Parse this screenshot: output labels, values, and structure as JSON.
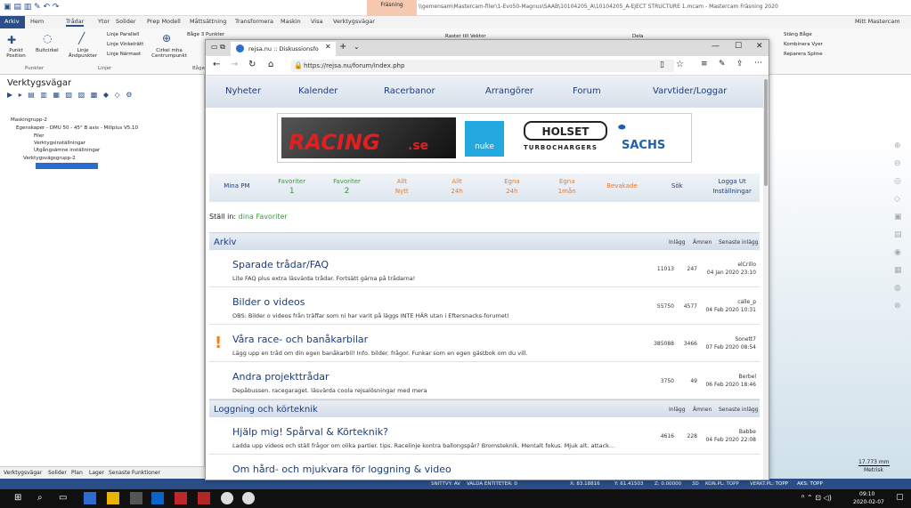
{
  "mastercam": {
    "title_path": "\\\\gemensam\\Mastercam-filer\\1-Evo50-Magnus\\SAAB\\10104205_A\\10104205_A-EJECT STRUCTURE 1.mcam - Mastercam Fräsning 2020",
    "context_tab": "Fräsning",
    "tabs": [
      "Arkiv",
      "Hem",
      "Trådar",
      "Ytor",
      "Solider",
      "Prep Modell",
      "Måttsättning",
      "Transformera",
      "Maskin",
      "Visa",
      "Verktygsvägar"
    ],
    "user": "Mitt Mastercam",
    "ribbon": {
      "punkt": "Punkt Position",
      "bultcirkel": "Bultcirkel",
      "linje_andp": "Linje Ändpunkter",
      "parallell": "Linje Parallell",
      "vinkelratt": "Linje Vinkelrätt",
      "narmast": "Linje Närmast",
      "cirkel": "Cirkel mha Centrumpunkt",
      "bage3": "Båge 3 Punkter",
      "group_punkter": "Punkter",
      "group_linjer": "Linjer",
      "group_bage": "Båge",
      "raster": "Raster till Vektor",
      "dela": "Dela",
      "stang": "Stäng Båge",
      "kombinera": "Kombinera Vyer",
      "reparera": "Reparera Spline"
    },
    "panel_title": "Verktygsvägar",
    "tree": [
      "Maskingrupp-2",
      "Egenskaper - DMU 50 - 45° B axis - Millplus V5.10",
      "Filer",
      "Verktygsinställningar",
      "Utgångsämne inställningar",
      "Verktygsvägsgrupp-2"
    ],
    "bottom_tabs": [
      "Verktygsvägar",
      "Solider",
      "Plan",
      "Lager",
      "Senaste Funktioner"
    ],
    "scale": "17.773 mm",
    "scale_unit": "Metrisk",
    "status": [
      "SNITTVY: AV",
      "VALDA ENTITETER: 0",
      "X:  83.18816",
      "Y:  61.41503",
      "Z:  0.00000",
      "3D",
      "KON.PL: TOPP",
      "VERKT.PL: TOPP",
      "AKS: TOPP"
    ]
  },
  "edge": {
    "tab_title": "rejsa.nu :: Diskussionsfo",
    "url_host": "rejsa.nu",
    "url": "https://rejsa.nu/forum/index.php",
    "nav": [
      "Nyheter",
      "Kalender",
      "Racerbanor",
      "Arrangörer",
      "Forum",
      "Varvtider/Loggar"
    ],
    "banner": {
      "racing": "RACING",
      "se": ".se",
      "nuke": "nuke",
      "holset": "HOLSET",
      "turbo": "TURBOCHARGERS",
      "sachs": "SACHS"
    },
    "links": [
      {
        "l1": "Mina PM",
        "l2": "",
        "color": "#1c3c7c"
      },
      {
        "l1": "Favoriter",
        "l2": "1",
        "color": "#3a9a3a"
      },
      {
        "l1": "Favoriter",
        "l2": "2",
        "color": "#3a9a3a"
      },
      {
        "l1": "Allt",
        "l2": "Nytt",
        "color": "#e67a2e"
      },
      {
        "l1": "Allt",
        "l2": "24h",
        "color": "#e67a2e"
      },
      {
        "l1": "Egna",
        "l2": "24h",
        "color": "#e67a2e"
      },
      {
        "l1": "Egna",
        "l2": "1mån",
        "color": "#e67a2e"
      },
      {
        "l1": "Bevakade",
        "l2": "",
        "color": "#e67a2e"
      },
      {
        "l1": "Sök",
        "l2": "",
        "color": "#1c3c7c"
      },
      {
        "l1": "Logga Ut",
        "l2": "Inställningar",
        "color": "#1c3c7c"
      }
    ],
    "stall_in": "Ställ in:",
    "stall_link": "dina Favoriter",
    "categories": [
      {
        "title": "Arkiv",
        "h_inlagg": "Inlägg",
        "h_amnen": "Ämnen",
        "h_senaste": "Senaste inlägg",
        "forums": [
          {
            "title": "Sparade trådar/FAQ",
            "desc": "Lite FAQ plus extra läsvärda trådar. Fortsätt gärna på trådarna!",
            "posts": "11013",
            "topics": "247",
            "user": "elCrillo",
            "date": "04 Jan 2020 23:10",
            "new": false
          },
          {
            "title": "Bilder o videos",
            "desc": "OBS: Bilder o videos från träffar som ni har varit på läggs INTE HÄR utan i Eftersnacks-forumet!",
            "posts": "55750",
            "topics": "4577",
            "user": "calle_p",
            "date": "04 Feb 2020 10:31",
            "new": false
          },
          {
            "title": "Våra race- och banåkarbilar",
            "desc": "Lägg upp en tråd om din egen banåkarbil! Info. bilder. frågor. Funkar som en egen gästbok om du vill.",
            "posts": "385088",
            "topics": "3466",
            "user": "Sonett7",
            "date": "07 Feb 2020 08:54",
            "new": true
          },
          {
            "title": "Andra projekttrådar",
            "desc": "Depåbussen. racegaraget. läsvärda coola rejsalösningar med mera",
            "posts": "3750",
            "topics": "49",
            "user": "Berbel",
            "date": "06 Feb 2020 18:46",
            "new": false
          }
        ]
      },
      {
        "title": "Loggning och körteknik",
        "h_inlagg": "Inlägg",
        "h_amnen": "Ämnen",
        "h_senaste": "Senaste inlägg",
        "forums": [
          {
            "title": "Hjälp mig! Spårval & Körteknik?",
            "desc": "Ladda upp videos och ställ frågor om olika partier. tips. Racelinje kontra ballongspår? Bromsteknik. Mentalt fokus. Mjuk alt. attack...",
            "posts": "4616",
            "topics": "228",
            "user": "Babbe",
            "date": "04 Feb 2020 22:08",
            "new": false
          },
          {
            "title": "Om hård- och mjukvara för loggning & video",
            "desc": "",
            "posts": "",
            "topics": "",
            "user": "",
            "date": "",
            "new": false
          }
        ]
      }
    ]
  },
  "taskbar": {
    "time": "09:10",
    "date": "2020-02-07"
  }
}
